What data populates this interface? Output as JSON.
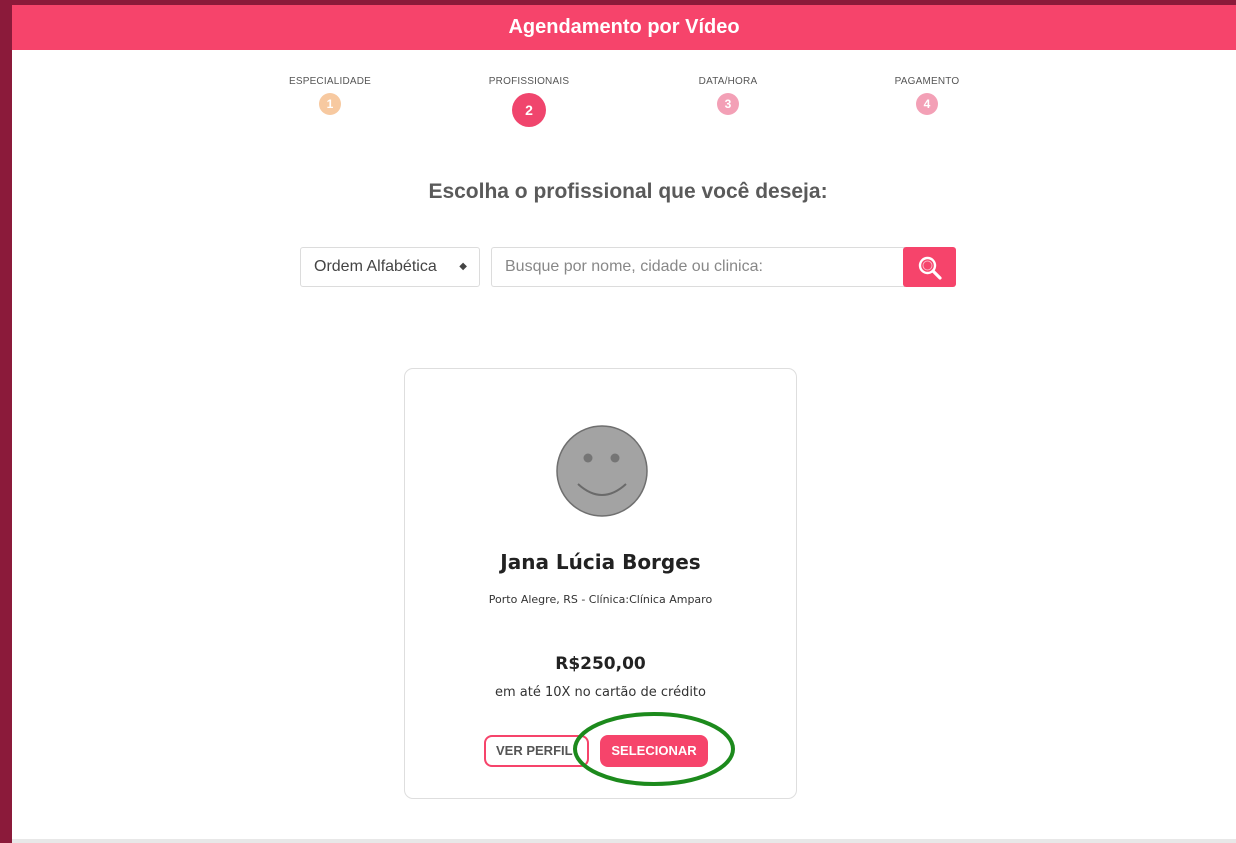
{
  "header": {
    "title": "Agendamento por Vídeo"
  },
  "steps": [
    {
      "label": "ESPECIALIDADE",
      "number": "1",
      "color": "#f7c9a0"
    },
    {
      "label": "PROFISSIONAIS",
      "number": "2",
      "color": "#f0456d"
    },
    {
      "label": "DATA/HORA",
      "number": "3",
      "color": "#f3a0b6"
    },
    {
      "label": "PAGAMENTO",
      "number": "4",
      "color": "#f3a0b6"
    }
  ],
  "main": {
    "title": "Escolha o profissional que você deseja:"
  },
  "filters": {
    "sort_value": "Ordem Alfabética",
    "search_placeholder": "Busque por nome, cidade ou clinica:"
  },
  "professional": {
    "name": "Jana Lúcia Borges",
    "location": "Porto Alegre, RS - Clínica:Clínica Amparo",
    "price": "R$250,00",
    "installments": "em até 10X no cartão de crédito",
    "profile_button": "VER PERFIL",
    "select_button": "SELECIONAR"
  },
  "colors": {
    "accent": "#f6446b",
    "frame": "#8b1a3a",
    "highlight_ring": "#1c8a1c"
  },
  "icons": {
    "search_button": "search-icon",
    "avatar": "smiley-avatar-icon",
    "sort_arrows": "sort-arrows-icon"
  }
}
